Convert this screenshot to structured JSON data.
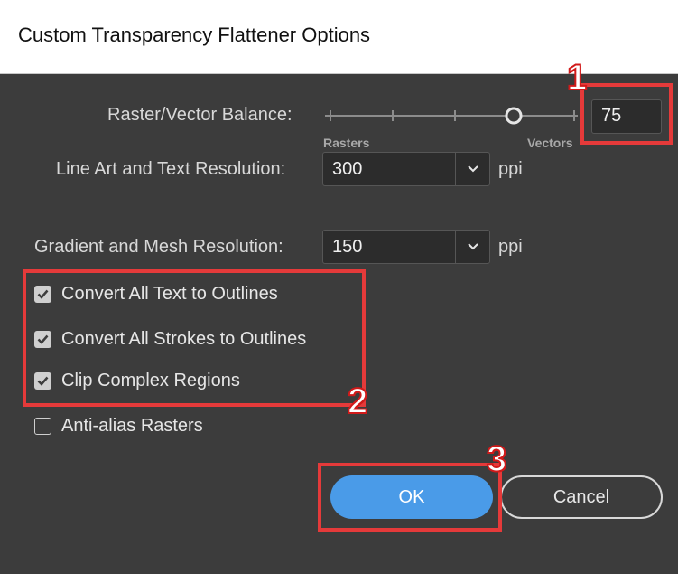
{
  "window": {
    "title": "Custom Transparency Flattener Options"
  },
  "balance": {
    "label": "Raster/Vector Balance:",
    "left_label": "Rasters",
    "right_label": "Vectors",
    "value": "75",
    "slider_fraction": 0.75
  },
  "line_art": {
    "label": "Line Art and Text Resolution:",
    "value": "300",
    "unit": "ppi"
  },
  "gradient": {
    "label": "Gradient and Mesh Resolution:",
    "value": "150",
    "unit": "ppi"
  },
  "options": [
    {
      "label": "Convert All Text to Outlines",
      "checked": true
    },
    {
      "label": "Convert All Strokes to Outlines",
      "checked": true
    },
    {
      "label": "Clip Complex Regions",
      "checked": true
    },
    {
      "label": "Anti-alias Rasters",
      "checked": false
    }
  ],
  "buttons": {
    "ok": "OK",
    "cancel": "Cancel"
  },
  "annotations": {
    "badge1": "1",
    "badge2": "2",
    "badge3": "3",
    "color": "#e53a3a"
  },
  "colors": {
    "dialog_bg": "#3c3c3c",
    "ok_button": "#4a9be8"
  }
}
